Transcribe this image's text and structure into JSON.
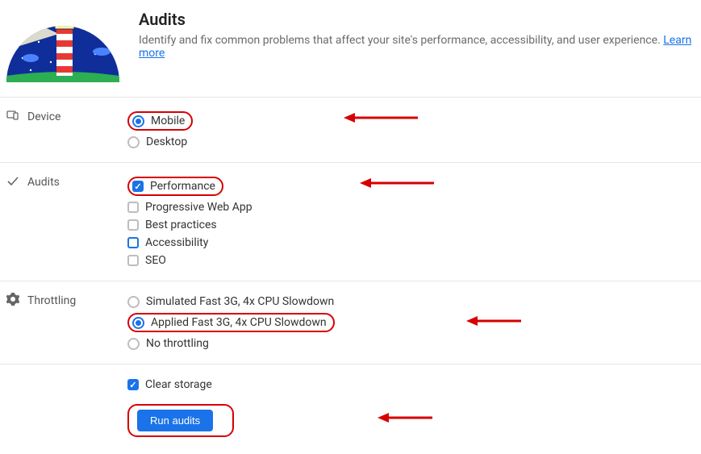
{
  "header": {
    "title": "Audits",
    "description": "Identify and fix common problems that affect your site's performance, accessibility, and user experience.",
    "learn_more": "Learn more"
  },
  "device": {
    "label": "Device",
    "mobile": "Mobile",
    "desktop": "Desktop"
  },
  "audits": {
    "label": "Audits",
    "performance": "Performance",
    "pwa": "Progressive Web App",
    "best_practices": "Best practices",
    "accessibility": "Accessibility",
    "seo": "SEO"
  },
  "throttling": {
    "label": "Throttling",
    "simulated": "Simulated Fast 3G, 4x CPU Slowdown",
    "applied": "Applied Fast 3G, 4x CPU Slowdown",
    "none": "No throttling"
  },
  "footer": {
    "clear_storage": "Clear storage",
    "run_button": "Run audits"
  }
}
